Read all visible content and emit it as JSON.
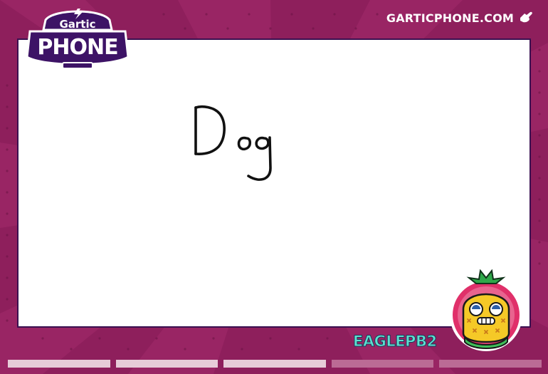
{
  "logo": {
    "top_text": "Gartic",
    "main_text": "PHONE"
  },
  "header": {
    "site_link": "GARTICPHONE.COM",
    "site_icon": "hand-pointer-icon"
  },
  "drawing": {
    "written_text": "Dog"
  },
  "player": {
    "name": "EAGLEPB2",
    "avatar": "pineapple-avatar-icon"
  },
  "progress": {
    "segments": 5,
    "completed": 3
  },
  "colors": {
    "background": "#8e1f5c",
    "canvas": "#ffffff",
    "logo_purple": "#3d1366",
    "name_teal": "#5ee0d0"
  }
}
